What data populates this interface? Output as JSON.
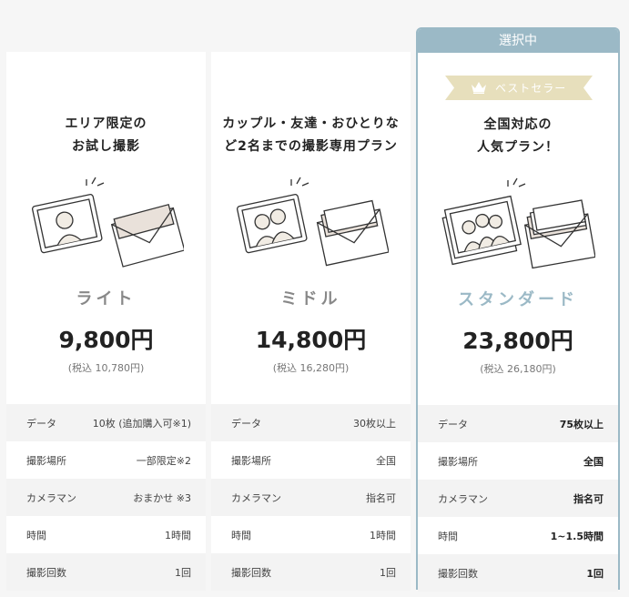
{
  "selected_tab_label": "選択中",
  "badge_label": "ベストセラー",
  "colors": {
    "accent": "#9bb9c6",
    "badge": "#e7dfbc",
    "row_shade": "#f3f3f3",
    "background": "#f6f6f6"
  },
  "plans": [
    {
      "headline": [
        "エリア限定の",
        "お試し撮影"
      ],
      "name": "ライト",
      "price": "9,800円",
      "tax": "(税込 10,780円)",
      "specs": [
        {
          "label": "データ",
          "value": "10枚 (追加購入可※1)"
        },
        {
          "label": "撮影場所",
          "value": "一部限定※2"
        },
        {
          "label": "カメラマン",
          "value": "おまかせ ※3"
        },
        {
          "label": "時間",
          "value": "1時間"
        },
        {
          "label": "撮影回数",
          "value": "1回"
        }
      ]
    },
    {
      "headline": [
        "カップル・友達・おひとりな",
        "ど2名までの撮影専用プラン"
      ],
      "name": "ミドル",
      "price": "14,800円",
      "tax": "(税込 16,280円)",
      "specs": [
        {
          "label": "データ",
          "value": "30枚以上"
        },
        {
          "label": "撮影場所",
          "value": "全国"
        },
        {
          "label": "カメラマン",
          "value": "指名可"
        },
        {
          "label": "時間",
          "value": "1時間"
        },
        {
          "label": "撮影回数",
          "value": "1回"
        }
      ]
    },
    {
      "headline": [
        "全国対応の",
        "人気プラン！"
      ],
      "name": "スタンダード",
      "price": "23,800円",
      "tax": "(税込 26,180円)",
      "specs": [
        {
          "label": "データ",
          "value": "75枚以上"
        },
        {
          "label": "撮影場所",
          "value": "全国"
        },
        {
          "label": "カメラマン",
          "value": "指名可"
        },
        {
          "label": "時間",
          "value": "1~1.5時間"
        },
        {
          "label": "撮影回数",
          "value": "1回"
        }
      ]
    }
  ]
}
